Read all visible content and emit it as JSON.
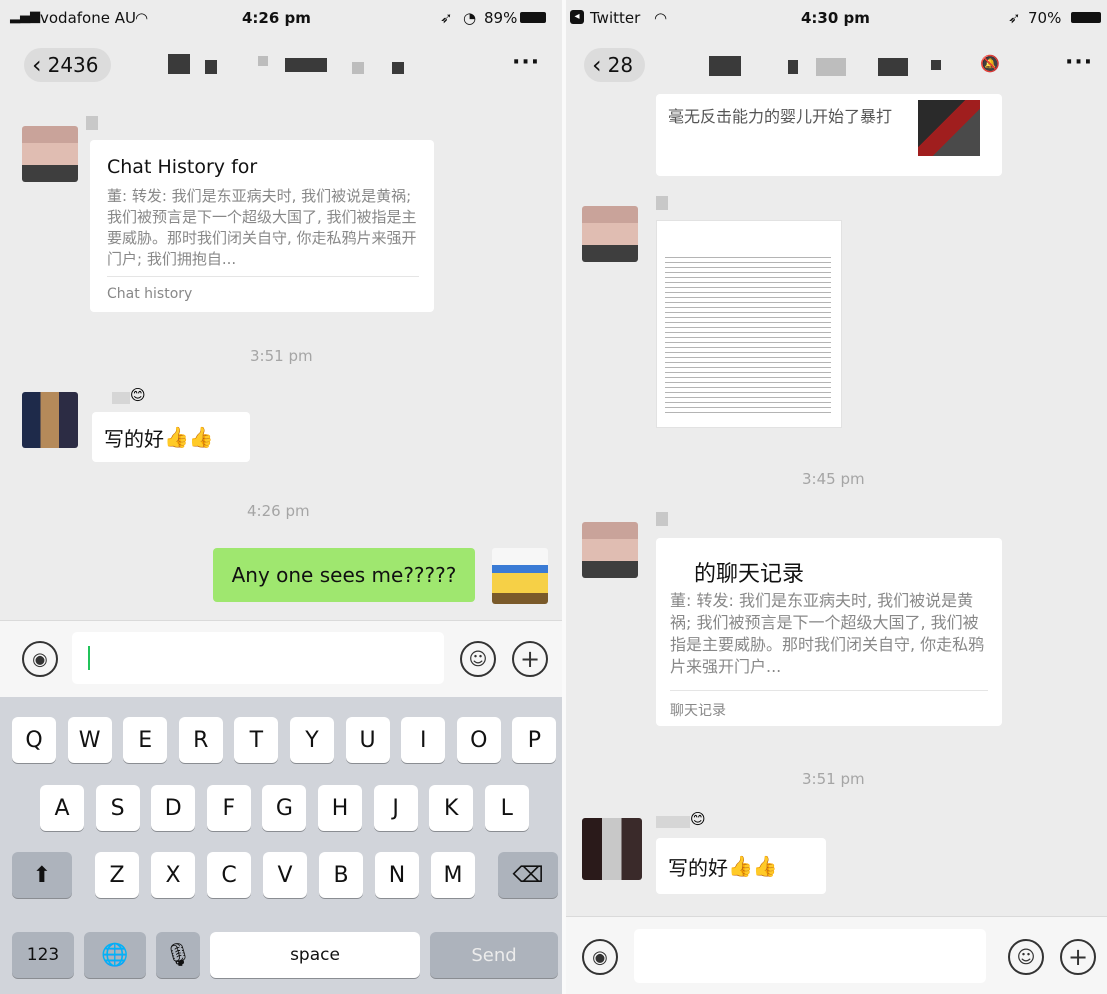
{
  "left": {
    "status": {
      "carrier": "vodafone AU",
      "time": "4:26 pm",
      "battery": "89%"
    },
    "nav": {
      "back_count": "2436"
    },
    "chat_card": {
      "title": "Chat History for",
      "body": "董: 转发: 我们是东亚病夫时, 我们被说是黄祸; 我们被预言是下一个超级大国了, 我们被指是主要威胁。那时我们闭关自守, 你走私鸦片来强开门户; 我们拥抱自...",
      "footer": "Chat history"
    },
    "timestamp_1": "3:51 pm",
    "message_1": {
      "text": "写的好",
      "emoji": "👍👍"
    },
    "timestamp_2": "4:26 pm",
    "message_2": {
      "text": "Any one sees me?????"
    },
    "keyboard": {
      "row1": [
        "Q",
        "W",
        "E",
        "R",
        "T",
        "Y",
        "U",
        "I",
        "O",
        "P"
      ],
      "row2": [
        "A",
        "S",
        "D",
        "F",
        "G",
        "H",
        "J",
        "K",
        "L"
      ],
      "row3": [
        "Z",
        "X",
        "C",
        "V",
        "B",
        "N",
        "M"
      ],
      "numbers_label": "123",
      "space_label": "space",
      "send_label": "Send"
    }
  },
  "right": {
    "status": {
      "app": "Twitter",
      "time": "4:30 pm",
      "battery": "70%"
    },
    "nav": {
      "back_count": "28"
    },
    "top_card": {
      "text": "毫无反击能力的婴儿开始了暴打"
    },
    "timestamp_1": "3:45 pm",
    "chat_card": {
      "title": "的聊天记录",
      "body": "董: 转发: 我们是东亚病夫时, 我们被说是黄祸; 我们被预言是下一个超级大国了, 我们被指是主要威胁。那时我们闭关自守, 你走私鸦片来强开门户...",
      "footer": "聊天记录"
    },
    "timestamp_2": "3:51 pm",
    "message_1": {
      "text": "写的好",
      "emoji": "👍👍"
    }
  },
  "icons": {
    "voice": "voice-icon",
    "emoji": "emoji-icon",
    "plus": "plus-icon",
    "more": "more-icon",
    "back": "back-icon"
  }
}
